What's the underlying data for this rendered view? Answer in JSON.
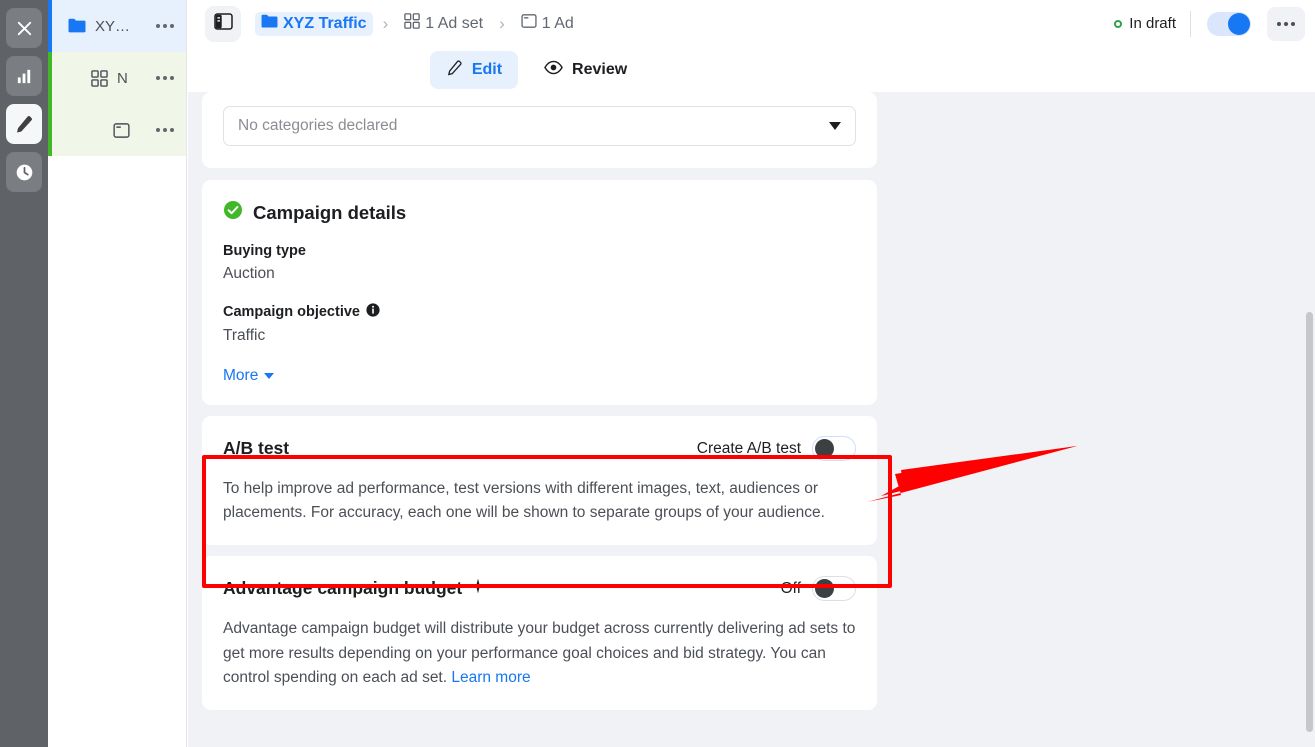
{
  "rail": {
    "items": [
      {
        "name": "close-icon",
        "label": "Close",
        "active": false
      },
      {
        "name": "chart-icon",
        "label": "Reports",
        "active": false
      },
      {
        "name": "pencil-icon",
        "label": "Edit",
        "active": true
      },
      {
        "name": "clock-icon",
        "label": "History",
        "active": false
      }
    ]
  },
  "sidebar": {
    "items": [
      {
        "label": "XY…",
        "icon": "folder-icon",
        "state": "selected"
      },
      {
        "label": "N",
        "icon": "grid-icon",
        "state": "green"
      },
      {
        "label": "",
        "icon": "ad-window-icon",
        "state": "green"
      }
    ],
    "overflow_label": "More options"
  },
  "header": {
    "panel_toggle_icon": "panel-toggle-icon",
    "breadcrumb": [
      {
        "label": "XYZ Traffic",
        "icon": "folder-icon",
        "current": true
      },
      {
        "label": "1 Ad set",
        "icon": "grid-icon",
        "current": false
      },
      {
        "label": "1 Ad",
        "icon": "ad-window-icon",
        "current": false
      }
    ],
    "separator": "›",
    "status": {
      "label": "In draft",
      "color": "#31a24c"
    },
    "publish_toggle": {
      "state": "on",
      "color": "#1877f2"
    },
    "overflow_label": "More"
  },
  "tabs": [
    {
      "label": "Edit",
      "icon": "pencil-icon",
      "active": true
    },
    {
      "label": "Review",
      "icon": "eye-icon",
      "active": false
    }
  ],
  "categories_card": {
    "select_value": "No categories declared",
    "caret_icon": "chevron-down-icon"
  },
  "campaign_details": {
    "title": "Campaign details",
    "status_icon": "check-circle-icon",
    "status_color": "#42b72a",
    "fields": [
      {
        "label": "Buying type",
        "value": "Auction",
        "info": false
      },
      {
        "label": "Campaign objective",
        "value": "Traffic",
        "info": true
      }
    ],
    "info_icon": "info-icon",
    "more_label": "More"
  },
  "ab_test": {
    "title": "A/B test",
    "toggle_label": "Create A/B test",
    "toggle_state": "off",
    "description": "To help improve ad performance, test versions with different images, text, audiences or placements. For accuracy, each one will be shown to separate groups of your audience."
  },
  "advantage_budget": {
    "title": "Advantage campaign budget",
    "sparkle_icon": "sparkle-icon",
    "toggle_label": "Off",
    "toggle_state": "off",
    "description": "Advantage campaign budget will distribute your budget across currently delivering ad sets to get more results depending on your performance goal choices and bid strategy. You can control spending on each ad set. ",
    "learn_more": "Learn more"
  },
  "annotation": {
    "highlight_color": "#ff0000",
    "target": "ab-test-card"
  }
}
